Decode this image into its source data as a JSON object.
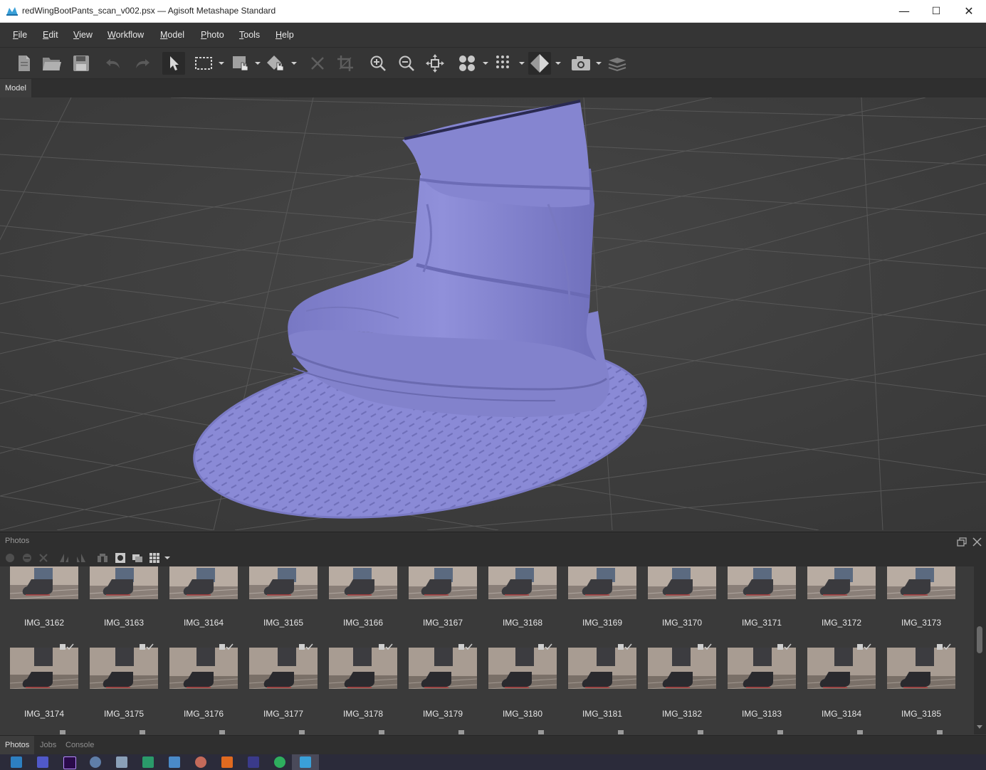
{
  "window": {
    "title": "redWingBootPants_scan_v002.psx — Agisoft Metashape Standard",
    "controls": {
      "minimize": "—",
      "maximize": "☐",
      "close": "✕"
    }
  },
  "menu": {
    "items": [
      "File",
      "Edit",
      "View",
      "Workflow",
      "Model",
      "Photo",
      "Tools",
      "Help"
    ]
  },
  "toolbar": {
    "icons": [
      "new-document-icon",
      "open-folder-icon",
      "save-icon",
      "undo-icon",
      "redo-icon",
      "navigation-pointer-icon",
      "rectangle-selection-icon",
      "model-selection-icon",
      "shape-tool-icon",
      "delete-selection-icon",
      "crop-selection-icon",
      "zoom-in-icon",
      "zoom-out-icon",
      "reset-view-icon",
      "point-cloud-icon",
      "dense-cloud-icon",
      "solid-model-icon",
      "camera-icon",
      "layers-icon"
    ]
  },
  "tabs": {
    "model": "Model"
  },
  "viewport": {
    "model_color": "#8c8cd8",
    "grid_color": "#5a5a5a"
  },
  "photos_panel": {
    "title": "Photos",
    "rows": [
      [
        "IMG_3162",
        "IMG_3163",
        "IMG_3164",
        "IMG_3165",
        "IMG_3166",
        "IMG_3167",
        "IMG_3168",
        "IMG_3169",
        "IMG_3170",
        "IMG_3171",
        "IMG_3172",
        "IMG_3173"
      ],
      [
        "IMG_3174",
        "IMG_3175",
        "IMG_3176",
        "IMG_3177",
        "IMG_3178",
        "IMG_3179",
        "IMG_3180",
        "IMG_3181",
        "IMG_3182",
        "IMG_3183",
        "IMG_3184",
        "IMG_3185"
      ]
    ]
  },
  "bottom_tabs": [
    "Photos",
    "Jobs",
    "Console"
  ],
  "colors": {
    "accent": "#8c8cd8",
    "panel_bg": "#353535",
    "viewport_bg": "#3c3c3c",
    "text": "#e6e6e6"
  }
}
